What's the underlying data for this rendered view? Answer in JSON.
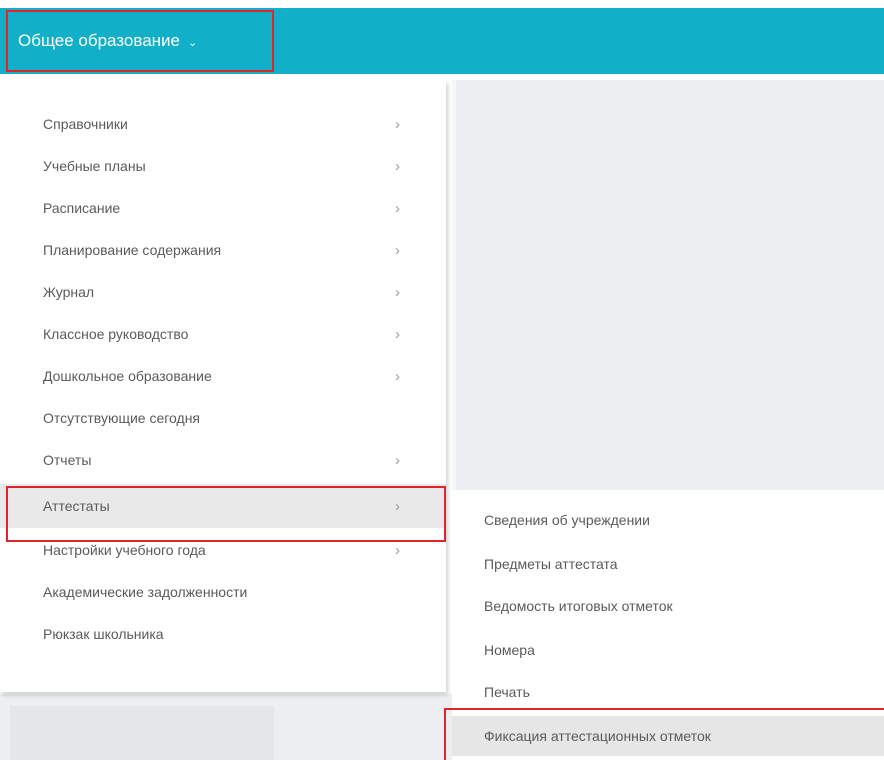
{
  "header": {
    "menu_label": "Общее образование",
    "menu_chevron": "⌄"
  },
  "main_menu": {
    "items": [
      {
        "label": "Справочники",
        "has_submenu": true
      },
      {
        "label": "Учебные планы",
        "has_submenu": true
      },
      {
        "label": "Расписание",
        "has_submenu": true
      },
      {
        "label": "Планирование содержания",
        "has_submenu": true
      },
      {
        "label": "Журнал",
        "has_submenu": true
      },
      {
        "label": "Классное руководство",
        "has_submenu": true
      },
      {
        "label": "Дошкольное образование",
        "has_submenu": true
      },
      {
        "label": "Отсутствующие сегодня",
        "has_submenu": false
      },
      {
        "label": "Отчеты",
        "has_submenu": true
      },
      {
        "label": "Аттестаты",
        "has_submenu": true,
        "active": true
      },
      {
        "label": "Настройки учебного года",
        "has_submenu": true
      },
      {
        "label": "Академические задолженности",
        "has_submenu": false
      },
      {
        "label": "Рюкзак школьника",
        "has_submenu": false
      }
    ],
    "arrow_glyph": "›"
  },
  "sub_menu": {
    "items": [
      {
        "label": "Сведения об учреждении"
      },
      {
        "label": "Предметы аттестата"
      },
      {
        "label": "Ведомость итоговых отметок"
      },
      {
        "label": "Номера"
      },
      {
        "label": "Печать"
      },
      {
        "label": "Фиксация аттестационных отметок",
        "active": true
      }
    ]
  },
  "colors": {
    "header_bg": "#12b0c8",
    "highlight": "#e0252b",
    "active_bg": "#e9e9e9",
    "page_bg": "#eceef1"
  }
}
